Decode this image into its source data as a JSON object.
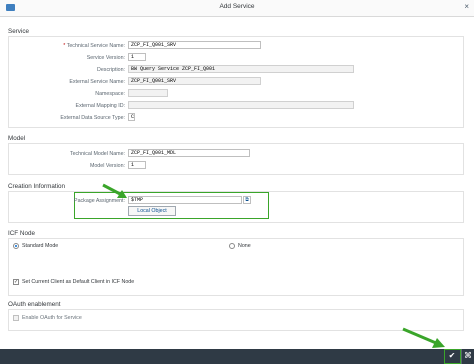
{
  "window": {
    "title": "Add Service",
    "close_glyph": "×",
    "app_icon": "window-icon"
  },
  "service": {
    "section_title": "Service",
    "technical_service_name": {
      "label": "Technical Service Name:",
      "required": "*",
      "value": "ZCP_FI_Q001_SRV"
    },
    "service_version": {
      "label": "Service Version:",
      "value": "1"
    },
    "description": {
      "label": "Description:",
      "value": "BW Query Service ZCP_FI_Q001"
    },
    "external_service_name": {
      "label": "External Service Name:",
      "value": "ZCP_FI_Q001_SRV"
    },
    "namespace": {
      "label": "Namespace:",
      "value": ""
    },
    "external_mapping_id": {
      "label": "External Mapping ID:",
      "value": ""
    },
    "external_data_source_type": {
      "label": "External Data Source Type:",
      "value": "C"
    }
  },
  "model": {
    "section_title": "Model",
    "technical_model_name": {
      "label": "Technical Model Name:",
      "value": "ZCP_FI_Q001_MDL"
    },
    "model_version": {
      "label": "Model Version:",
      "value": "1"
    }
  },
  "creation": {
    "section_title": "Creation Information",
    "package_assignment": {
      "label": "Package Assignment:",
      "value": "$TMP"
    },
    "local_object_button": "Local Object"
  },
  "icf": {
    "section_title": "ICF Node",
    "standard_mode": "Standard Mode",
    "none": "None",
    "set_current_client": "Set Current Client as Default Client in ICF Node",
    "selected_mode": "Standard Mode"
  },
  "oauth": {
    "section_title": "OAuth enablement",
    "enable_oauth": "Enable OAuth for Service"
  },
  "footer": {
    "confirm_icon": "checkmark-icon",
    "cancel_icon": "cancel-icon"
  },
  "colors": {
    "highlight": "#3aa52a",
    "footer_bg": "#2f3a45"
  }
}
